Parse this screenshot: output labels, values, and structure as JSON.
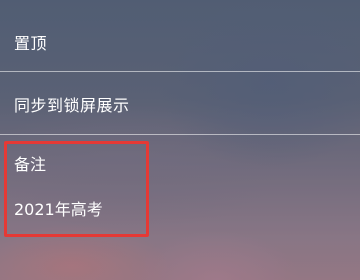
{
  "menu": {
    "items": [
      {
        "label": "置顶"
      },
      {
        "label": "同步到锁屏展示"
      }
    ]
  },
  "note": {
    "label": "备注",
    "value": "2021年高考"
  },
  "colors": {
    "highlight_border": "#e53935",
    "text": "#ffffff"
  }
}
